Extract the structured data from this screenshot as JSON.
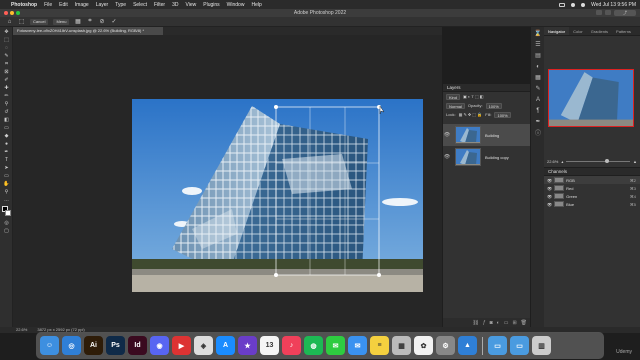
{
  "menubar": {
    "app": "Photoshop",
    "items": [
      "File",
      "Edit",
      "Image",
      "Layer",
      "Type",
      "Select",
      "Filter",
      "3D",
      "View",
      "Plugins",
      "Window",
      "Help"
    ],
    "clock": "Wed Jul 13  9:56 PM"
  },
  "window": {
    "title": "Adobe Photoshop 2022"
  },
  "options": {
    "btn_cancel": "Cancel",
    "btn_help": "Menu"
  },
  "document": {
    "tab_title": "Fotosveny-lee-o9xZ0H41IbV-unsplash.jpg @ 22.6% (Building, RGB/8) *"
  },
  "layers": {
    "title": "Layers",
    "kind": "Kind",
    "blend": "Normal",
    "opacity_label": "Opacity:",
    "opacity": "100%",
    "lock_label": "Lock:",
    "fill_label": "Fill:",
    "fill": "100%",
    "items": [
      {
        "name": "Building"
      },
      {
        "name": "Building copy"
      }
    ]
  },
  "navigator": {
    "tabs": [
      "Navigator",
      "Color",
      "Gradients",
      "Patterns"
    ],
    "zoom": "22.6%"
  },
  "channels": {
    "title": "Channels",
    "items": [
      {
        "name": "RGB",
        "key": "⌘2"
      },
      {
        "name": "Red",
        "key": "⌘3"
      },
      {
        "name": "Green",
        "key": "⌘4"
      },
      {
        "name": "Blue",
        "key": "⌘5"
      }
    ]
  },
  "status": {
    "zoom": "22.6%",
    "info": "3872 px x 2592 px (72 ppi)"
  },
  "dock": {
    "apps": [
      {
        "name": "Finder",
        "label": "☺",
        "color": "#3d8fe0"
      },
      {
        "name": "Safari",
        "label": "◎",
        "color": "#2f7fd6"
      },
      {
        "name": "Illustrator",
        "label": "Ai",
        "color": "#2e1c08"
      },
      {
        "name": "Photoshop",
        "label": "Ps",
        "color": "#0f2a48"
      },
      {
        "name": "InDesign",
        "label": "Id",
        "color": "#3a0a1f"
      },
      {
        "name": "Discord",
        "label": "◉",
        "color": "#5865f2"
      },
      {
        "name": "Screen Recorder",
        "label": "▶",
        "color": "#d33"
      },
      {
        "name": "Unity",
        "label": "◈",
        "color": "#ddd"
      },
      {
        "name": "App Store",
        "label": "A",
        "color": "#1a8cff"
      },
      {
        "name": "iMovie",
        "label": "★",
        "color": "#6a3dc8"
      },
      {
        "name": "Calendar",
        "label": "13",
        "color": "#f5f5f5"
      },
      {
        "name": "Music",
        "label": "♪",
        "color": "#f0405a"
      },
      {
        "name": "Spotify",
        "label": "◍",
        "color": "#1db954"
      },
      {
        "name": "Messages",
        "label": "✉",
        "color": "#2ecc40"
      },
      {
        "name": "Mail",
        "label": "✉",
        "color": "#3a92f0"
      },
      {
        "name": "Notes",
        "label": "≡",
        "color": "#f4d03f"
      },
      {
        "name": "Preview",
        "label": "▦",
        "color": "#bbb"
      },
      {
        "name": "Photos",
        "label": "✿",
        "color": "#f2f2f2"
      },
      {
        "name": "System Preferences",
        "label": "⚙",
        "color": "#888"
      },
      {
        "name": "Keynote",
        "label": "▲",
        "color": "#2f7fd6"
      },
      {
        "name": "Folder",
        "label": "▭",
        "color": "#4a9be0"
      },
      {
        "name": "Downloads",
        "label": "▭",
        "color": "#4a9be0"
      },
      {
        "name": "Trash",
        "label": "▥",
        "color": "#ccc"
      }
    ]
  },
  "watermark": "Udemy"
}
